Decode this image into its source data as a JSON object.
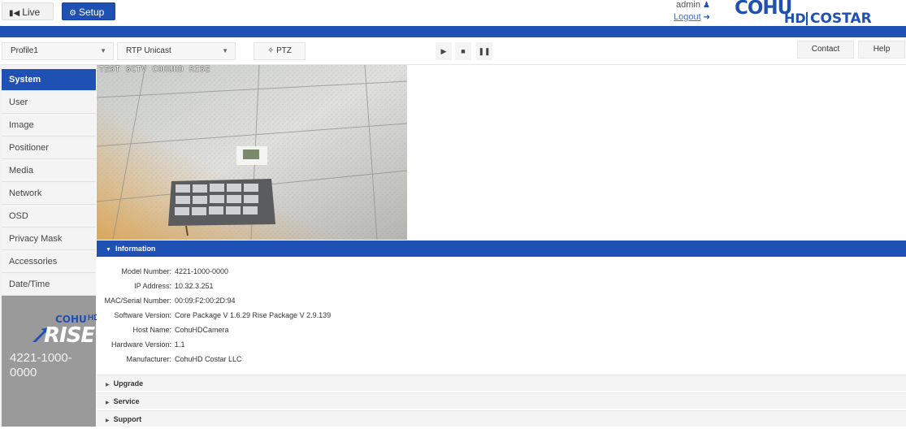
{
  "top": {
    "live_label": "Live",
    "setup_label": "Setup",
    "user_name": "admin",
    "logout_label": "Logout"
  },
  "logo": {
    "cohu": "COHU",
    "hd": "HD",
    "costar": "COSTAR"
  },
  "controls": {
    "profile_value": "Profile1",
    "stream_value": "RTP Unicast",
    "ptz_label": "PTZ",
    "contact_label": "Contact",
    "help_label": "Help"
  },
  "sidebar": {
    "items": [
      {
        "label": "System"
      },
      {
        "label": "User"
      },
      {
        "label": "Image"
      },
      {
        "label": "Positioner"
      },
      {
        "label": "Media"
      },
      {
        "label": "Network"
      },
      {
        "label": "OSD"
      },
      {
        "label": "Privacy Mask"
      },
      {
        "label": "Accessories"
      },
      {
        "label": "Date/Time"
      }
    ],
    "active_index": 0,
    "brand_cohu": "COHU",
    "brand_hd": "HD",
    "brand_rise": "RISE",
    "model": "4221-1000-0000"
  },
  "video": {
    "osd_text": "TEST SCTV COHUHD RISE"
  },
  "information": {
    "header": "Information",
    "rows": [
      {
        "label": "Model Number:",
        "value": "4221-1000-0000"
      },
      {
        "label": "IP Address:",
        "value": "10.32.3.251"
      },
      {
        "label": "MAC/Serial Number:",
        "value": "00:09:F2:00:2D:94"
      },
      {
        "label": "Software Version:",
        "value": "Core Package V 1.6.29 Rise Package V 2.9.139"
      },
      {
        "label": "Host Name:",
        "value": "CohuHDCamera"
      },
      {
        "label": "Hardware Version:",
        "value": "1.1"
      },
      {
        "label": "Manufacturer:",
        "value": "CohuHD Costar LLC"
      }
    ]
  },
  "accordions": {
    "upgrade": "Upgrade",
    "service": "Service",
    "support": "Support"
  },
  "colors": {
    "brand_blue": "#1f50b4"
  }
}
